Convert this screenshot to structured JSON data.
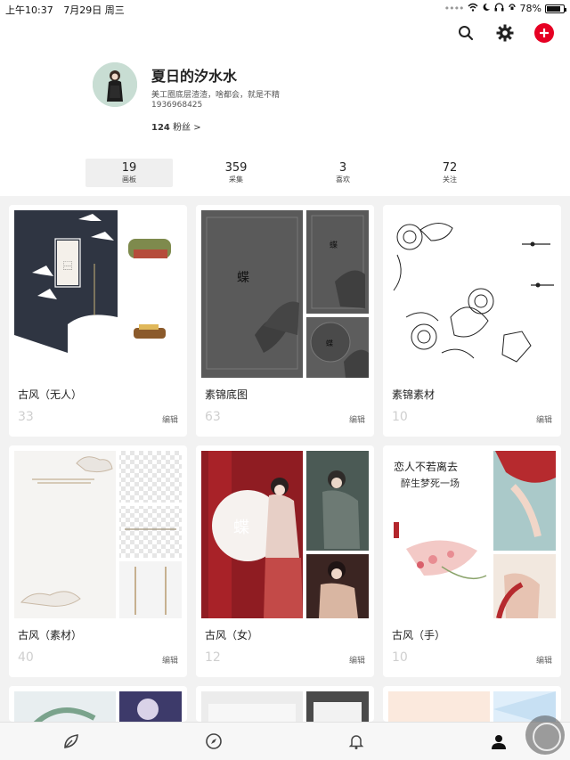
{
  "status_bar": {
    "time": "上午10:37",
    "date": "7月29日 周三",
    "battery": "78%"
  },
  "profile": {
    "name": "夏日的汐水水",
    "bio_line1": "美工圈底层渣渣，啥都会，就是不精",
    "bio_line2": "1936968425",
    "followers_count": "124",
    "followers_label": "粉丝",
    "followers_chevron": ">"
  },
  "stats": [
    {
      "num": "19",
      "label": "画板"
    },
    {
      "num": "359",
      "label": "采集"
    },
    {
      "num": "3",
      "label": "喜欢"
    },
    {
      "num": "72",
      "label": "关注"
    }
  ],
  "boards": [
    {
      "title": "古风（无人）",
      "count": "33",
      "edit": "编辑"
    },
    {
      "title": "素锦底图",
      "count": "63",
      "edit": "编辑"
    },
    {
      "title": "素锦素材",
      "count": "10",
      "edit": "编辑"
    },
    {
      "title": "古风（素材）",
      "count": "40",
      "edit": "编辑"
    },
    {
      "title": "古风（女）",
      "count": "12",
      "edit": "编辑"
    },
    {
      "title": "古风（手）",
      "count": "10",
      "edit": "编辑"
    }
  ],
  "tabs": [
    "home-icon",
    "compass-icon",
    "bell-icon",
    "profile-icon"
  ],
  "colors": {
    "accent": "#e60023",
    "card_bg": "#ffffff",
    "page_bg": "#f2f2f2"
  }
}
